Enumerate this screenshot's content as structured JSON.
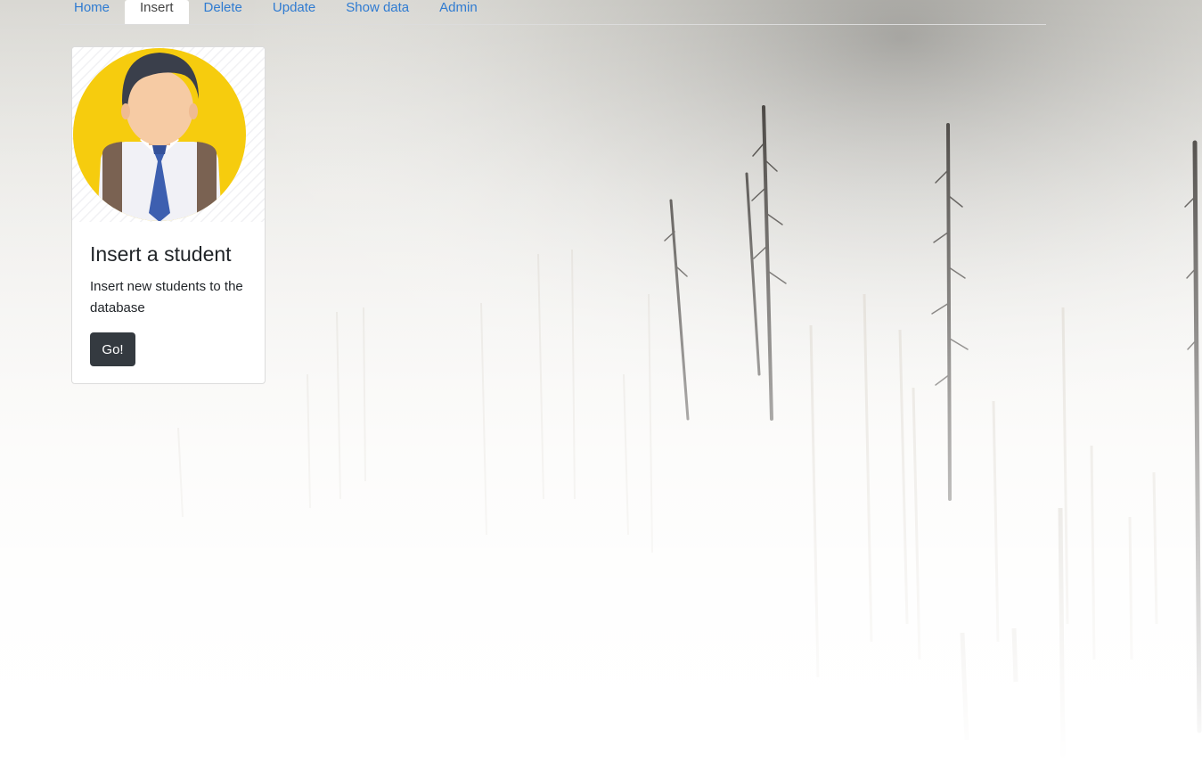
{
  "nav": {
    "items": [
      {
        "label": "Home",
        "active": false
      },
      {
        "label": "Insert",
        "active": true
      },
      {
        "label": "Delete",
        "active": false
      },
      {
        "label": "Update",
        "active": false
      },
      {
        "label": "Show data",
        "active": false
      },
      {
        "label": "Admin",
        "active": false
      }
    ]
  },
  "card": {
    "image_icon": "student-avatar-icon",
    "title": "Insert a student",
    "text": "Insert new students to the database",
    "button_label": "Go!"
  },
  "background": {
    "image": "foggy-forest-photo"
  },
  "colors": {
    "link": "#2f7bd1",
    "button_bg": "#343a40",
    "avatar_yellow": "#f6cc0e",
    "tie_blue": "#3d5fb0"
  }
}
